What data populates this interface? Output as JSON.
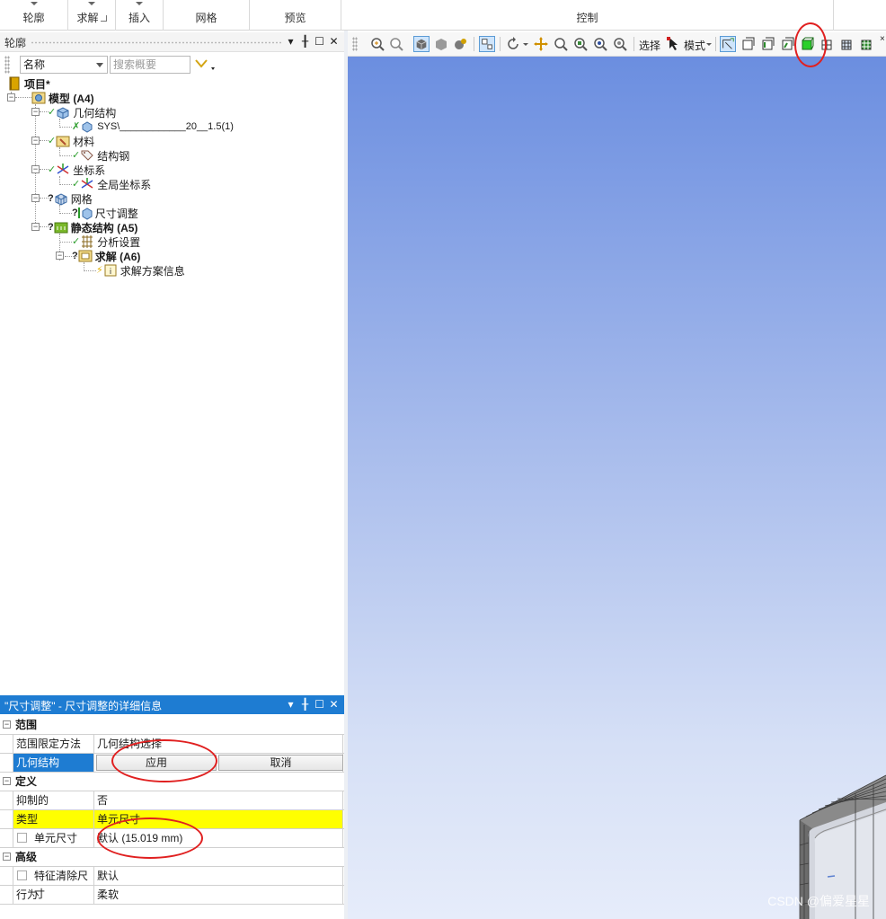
{
  "ribbon": {
    "groups": [
      {
        "label": "轮廓"
      },
      {
        "label": "求解"
      },
      {
        "label": "插入"
      },
      {
        "label": "网格"
      },
      {
        "label": "预览"
      },
      {
        "label": "控制"
      }
    ]
  },
  "outline": {
    "title": "轮廓",
    "name_select": "名称",
    "search_placeholder": "搜索概要",
    "tree": {
      "project": "项目*",
      "model": "模型 (A4)",
      "geometry": "几何结构",
      "geometry_part": "SYS\\____________20__1.5(1)",
      "materials": "材料",
      "material_item": "结构钢",
      "coordinate_systems": "坐标系",
      "global_cs": "全局坐标系",
      "mesh": "网格",
      "sizing": "尺寸调整",
      "static_structural": "静态结构 (A5)",
      "analysis_settings": "分析设置",
      "solution": "求解 (A6)",
      "solution_info": "求解方案信息"
    }
  },
  "details": {
    "title": "\"尺寸调整\" - 尺寸调整的详细信息",
    "sections": {
      "scope": "范围",
      "definition": "定义",
      "advanced": "高级"
    },
    "rows": {
      "scoping_method_label": "范围限定方法",
      "scoping_method_value": "几何结构选择",
      "geometry_label": "几何结构",
      "apply_button": "应用",
      "cancel_button": "取消",
      "suppressed_label": "抑制的",
      "suppressed_value": "否",
      "type_label": "类型",
      "type_value": "单元尺寸",
      "element_size_label": "单元尺寸",
      "element_size_value": "默认 (15.019 mm)",
      "defeature_label": "特征清除尺寸",
      "defeature_value": "默认",
      "behavior_label": "行为",
      "behavior_value": "柔软"
    }
  },
  "graphics_toolbar": {
    "select_label": "选择",
    "mode_label": "模式"
  },
  "watermark": "CSDN @偏爱星星",
  "colors": {
    "accent": "#1e7cd2",
    "highlight": "#ffff00",
    "annotation": "#e02020",
    "viewport_top": "#6b8ee0",
    "viewport_bottom": "#e6ecfa"
  }
}
